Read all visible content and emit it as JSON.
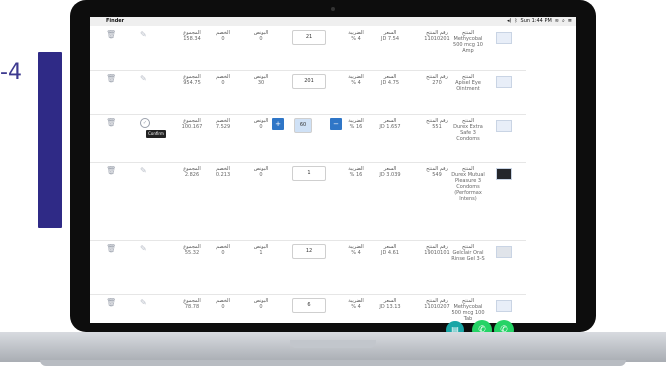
{
  "menubar": {
    "app": "Finder",
    "time": "Sun 1:44 PM"
  },
  "deco": {
    "fragment": "-4"
  },
  "headers": {
    "product": "المنتج",
    "product_no": "رقم المنتج",
    "price": "السعر",
    "tax": "الضريبة",
    "bonus": "البونص",
    "discount": "الخصم",
    "total": "المجموع"
  },
  "tooltip": "Confirm",
  "rows": [
    {
      "product": "Methycobal 500 mcg 10 Amp",
      "product_no": "11010201",
      "price": "JD 7.54",
      "tax": "% 4",
      "qty": "21",
      "bonus": "0",
      "discount": "0",
      "total": "158.34"
    },
    {
      "product": "Apisel Eye Ointment",
      "product_no": "270",
      "price": "JD 4.75",
      "tax": "% 4",
      "qty": "201",
      "bonus": "30",
      "discount": "0",
      "total": "954.75"
    },
    {
      "product": "Durex Extra Safe 3 Condoms",
      "product_no": "551",
      "price": "JD 1.657",
      "tax": "% 16",
      "qty": "60",
      "bonus": "0",
      "discount": "7.529",
      "total": "100.167"
    },
    {
      "product": "Durex Mutual Pleasure 3 Condoms (Performax Intens)",
      "product_no": "549",
      "price": "JD 3.039",
      "tax": "% 16",
      "qty": "1",
      "bonus": "0",
      "discount": "0.213",
      "total": "2.826"
    },
    {
      "product": "Gelclair Oral Rinse Gel 3-S",
      "product_no": "19010101",
      "price": "JD 4.61",
      "tax": "% 4",
      "qty": "12",
      "bonus": "1",
      "discount": "0",
      "total": "55.32"
    },
    {
      "product": "Methycobal 500 mcg 100 Tab",
      "product_no": "11010207",
      "price": "JD 13.13",
      "tax": "% 4",
      "qty": "6",
      "bonus": "0",
      "discount": "0",
      "total": "78.78"
    }
  ],
  "colors": {
    "accent": "#2f76c7",
    "teal": "#1f9da8",
    "whatsapp": "#25d366",
    "deco_bar": "#2f2a86"
  }
}
